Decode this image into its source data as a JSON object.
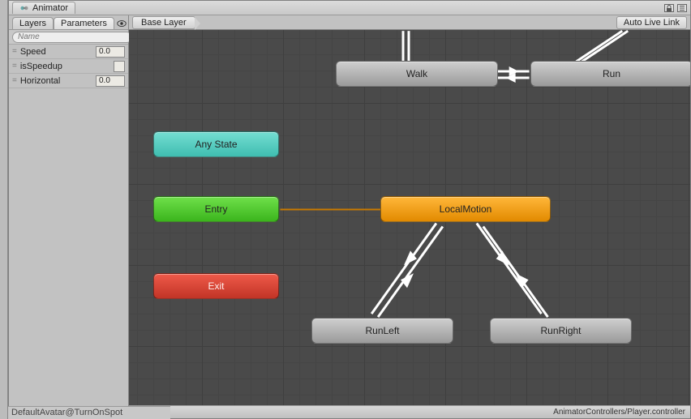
{
  "window": {
    "title": "Animator"
  },
  "window_controls": {
    "lock_icon": "lock-icon",
    "menu_icon": "menu-icon"
  },
  "left_tabs": {
    "layers": "Layers",
    "parameters": "Parameters"
  },
  "search": {
    "placeholder": "Name"
  },
  "add_button": {
    "label": "+"
  },
  "parameters": [
    {
      "name": "Speed",
      "type": "float",
      "value": "0.0"
    },
    {
      "name": "isSpeedup",
      "type": "bool",
      "value": false
    },
    {
      "name": "Horizontal",
      "type": "float",
      "value": "0.0"
    }
  ],
  "breadcrumb": {
    "root": "Base Layer"
  },
  "auto_live_link": {
    "label": "Auto Live Link"
  },
  "nodes": {
    "any_state": {
      "label": "Any State"
    },
    "entry": {
      "label": "Entry"
    },
    "exit": {
      "label": "Exit"
    },
    "walk": {
      "label": "Walk"
    },
    "run": {
      "label": "Run"
    },
    "local_motion": {
      "label": "LocalMotion"
    },
    "run_left": {
      "label": "RunLeft"
    },
    "run_right": {
      "label": "RunRight"
    }
  },
  "statusbar": {
    "path": "AnimatorControllers/Player.controller"
  },
  "bottom_strip": {
    "text": "DefaultAvatar@TurnOnSpot"
  }
}
